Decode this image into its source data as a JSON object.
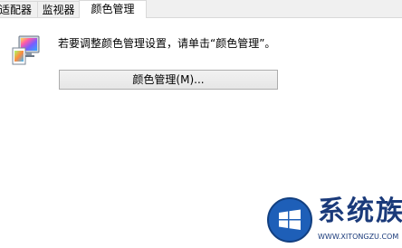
{
  "tabs": [
    {
      "label": "适配器"
    },
    {
      "label": "监视器"
    },
    {
      "label": "颜色管理"
    }
  ],
  "color_management": {
    "instruction": "若要调整颜色管理设置，请单击“颜色管理”。",
    "button_label": "颜色管理(M)..."
  },
  "watermark": {
    "brand": "系统族",
    "url": "WWW.XITONGZU.COM"
  },
  "colors": {
    "tab_bg": "#f0f0f0",
    "button_border": "#adadad",
    "watermark_blue": "#1a3a7a"
  }
}
